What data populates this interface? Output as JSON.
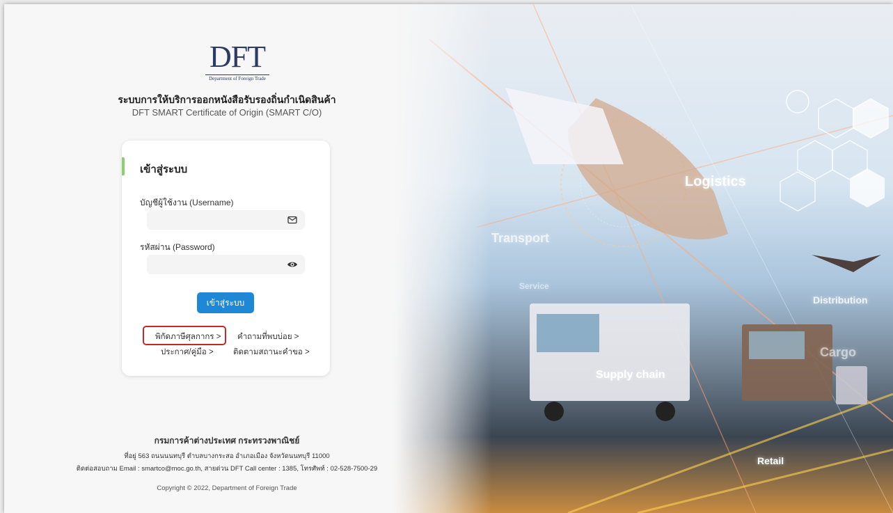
{
  "brand": {
    "logo_text": "DFT",
    "logo_sub": "Department of Foreign Trade"
  },
  "header": {
    "title_th": "ระบบการให้บริการออกหนังสือรับรองถิ่นกำเนิดสินค้า",
    "title_en": "DFT SMART Certificate of Origin (SMART C/O)"
  },
  "login": {
    "heading": "เข้าสู่ระบบ",
    "username_label": "บัญชีผู้ใช้งาน (Username)",
    "username_value": "",
    "password_label": "รหัสผ่าน (Password)",
    "password_value": "",
    "submit_label": "เข้าสู่ระบบ",
    "links": {
      "tariff": "พิกัดภาษีศุลกากร >",
      "faq": "คำถามที่พบบ่อย >",
      "announcements": "ประกาศ/คู่มือ >",
      "track": "ติดตามสถานะคำขอ >"
    }
  },
  "footer": {
    "org": "กรมการค้าต่างประเทศ กระทรวงพาณิชย์",
    "address": "ที่อยู่ 563 ถนนนนทบุรี ตำบลบางกระสอ อำเภอเมือง จังหวัดนนทบุรี 11000",
    "contact": "ติดต่อสอบถาม Email : smartco@moc.go.th, สายด่วน DFT Call center : 1385, โทรศัพท์ : 02-528-7500-29",
    "copyright": "Copyright © 2022, Department of Foreign Trade"
  },
  "hero_image": {
    "labels": [
      "Logistics",
      "Transport",
      "Service",
      "Distribution",
      "Cargo",
      "Supply chain",
      "Retail"
    ]
  },
  "colors": {
    "primary_button": "#1e88d6",
    "accent_bar": "#8ccf6e",
    "highlight_box": "#c62828",
    "logo": "#2b3a66"
  }
}
